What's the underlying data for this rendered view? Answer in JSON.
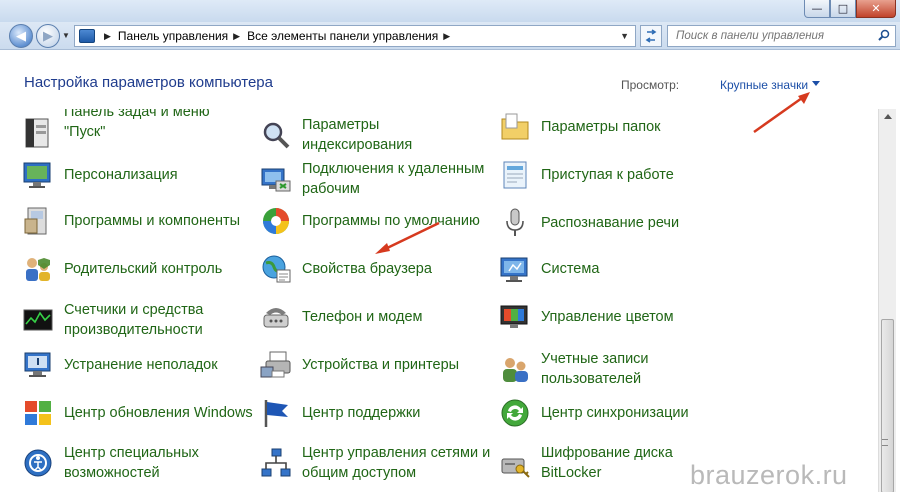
{
  "window": {
    "buttons": {
      "minimize": "—",
      "maximize": "□",
      "close": "✕"
    }
  },
  "address_bar": {
    "breadcrumbs": [
      "Панель управления",
      "Все элементы панели управления"
    ],
    "search_placeholder": "Поиск в панели управления"
  },
  "header": {
    "title": "Настройка параметров компьютера",
    "view_label": "Просмотр:",
    "view_value": "Крупные значки"
  },
  "items": {
    "c0": [
      {
        "label": "Панель задач и меню \"Пуск\"",
        "icon": "taskbar-icon"
      },
      {
        "label": "Персонализация",
        "icon": "personalization-icon"
      },
      {
        "label": "Программы и компоненты",
        "icon": "programs-icon"
      },
      {
        "label": "Родительский контроль",
        "icon": "parental-control-icon"
      },
      {
        "label": "Счетчики и средства производительности",
        "icon": "performance-icon"
      },
      {
        "label": "Устранение неполадок",
        "icon": "troubleshooting-icon"
      },
      {
        "label": "Центр обновления Windows",
        "icon": "windows-update-icon"
      },
      {
        "label": "Центр специальных возможностей",
        "icon": "accessibility-icon"
      }
    ],
    "c1": [
      {
        "label": "Параметры индексирования",
        "icon": "indexing-icon"
      },
      {
        "label": "Подключения к удаленным рабочим",
        "icon": "remote-desktop-icon"
      },
      {
        "label": "Программы по умолчанию",
        "icon": "default-programs-icon"
      },
      {
        "label": "Свойства браузера",
        "icon": "browser-properties-icon"
      },
      {
        "label": "Телефон и модем",
        "icon": "phone-modem-icon"
      },
      {
        "label": "Устройства и принтеры",
        "icon": "devices-printers-icon"
      },
      {
        "label": "Центр поддержки",
        "icon": "action-center-icon"
      },
      {
        "label": "Центр управления сетями и общим доступом",
        "icon": "network-center-icon"
      }
    ],
    "c2": [
      {
        "label": "Параметры папок",
        "icon": "folder-options-icon"
      },
      {
        "label": "Приступая к работе",
        "icon": "getting-started-icon"
      },
      {
        "label": "Распознавание речи",
        "icon": "speech-recognition-icon"
      },
      {
        "label": "Система",
        "icon": "system-icon"
      },
      {
        "label": "Управление цветом",
        "icon": "color-management-icon"
      },
      {
        "label": "Учетные записи пользователей",
        "icon": "user-accounts-icon"
      },
      {
        "label": "Центр синхронизации",
        "icon": "sync-center-icon"
      },
      {
        "label": "Шифрование диска BitLocker",
        "icon": "bitlocker-icon"
      }
    ]
  },
  "watermark": "brauzerok.ru",
  "colors": {
    "link_green": "#206616",
    "title_blue": "#1f3c8d",
    "arrow_red": "#d63a1f"
  }
}
